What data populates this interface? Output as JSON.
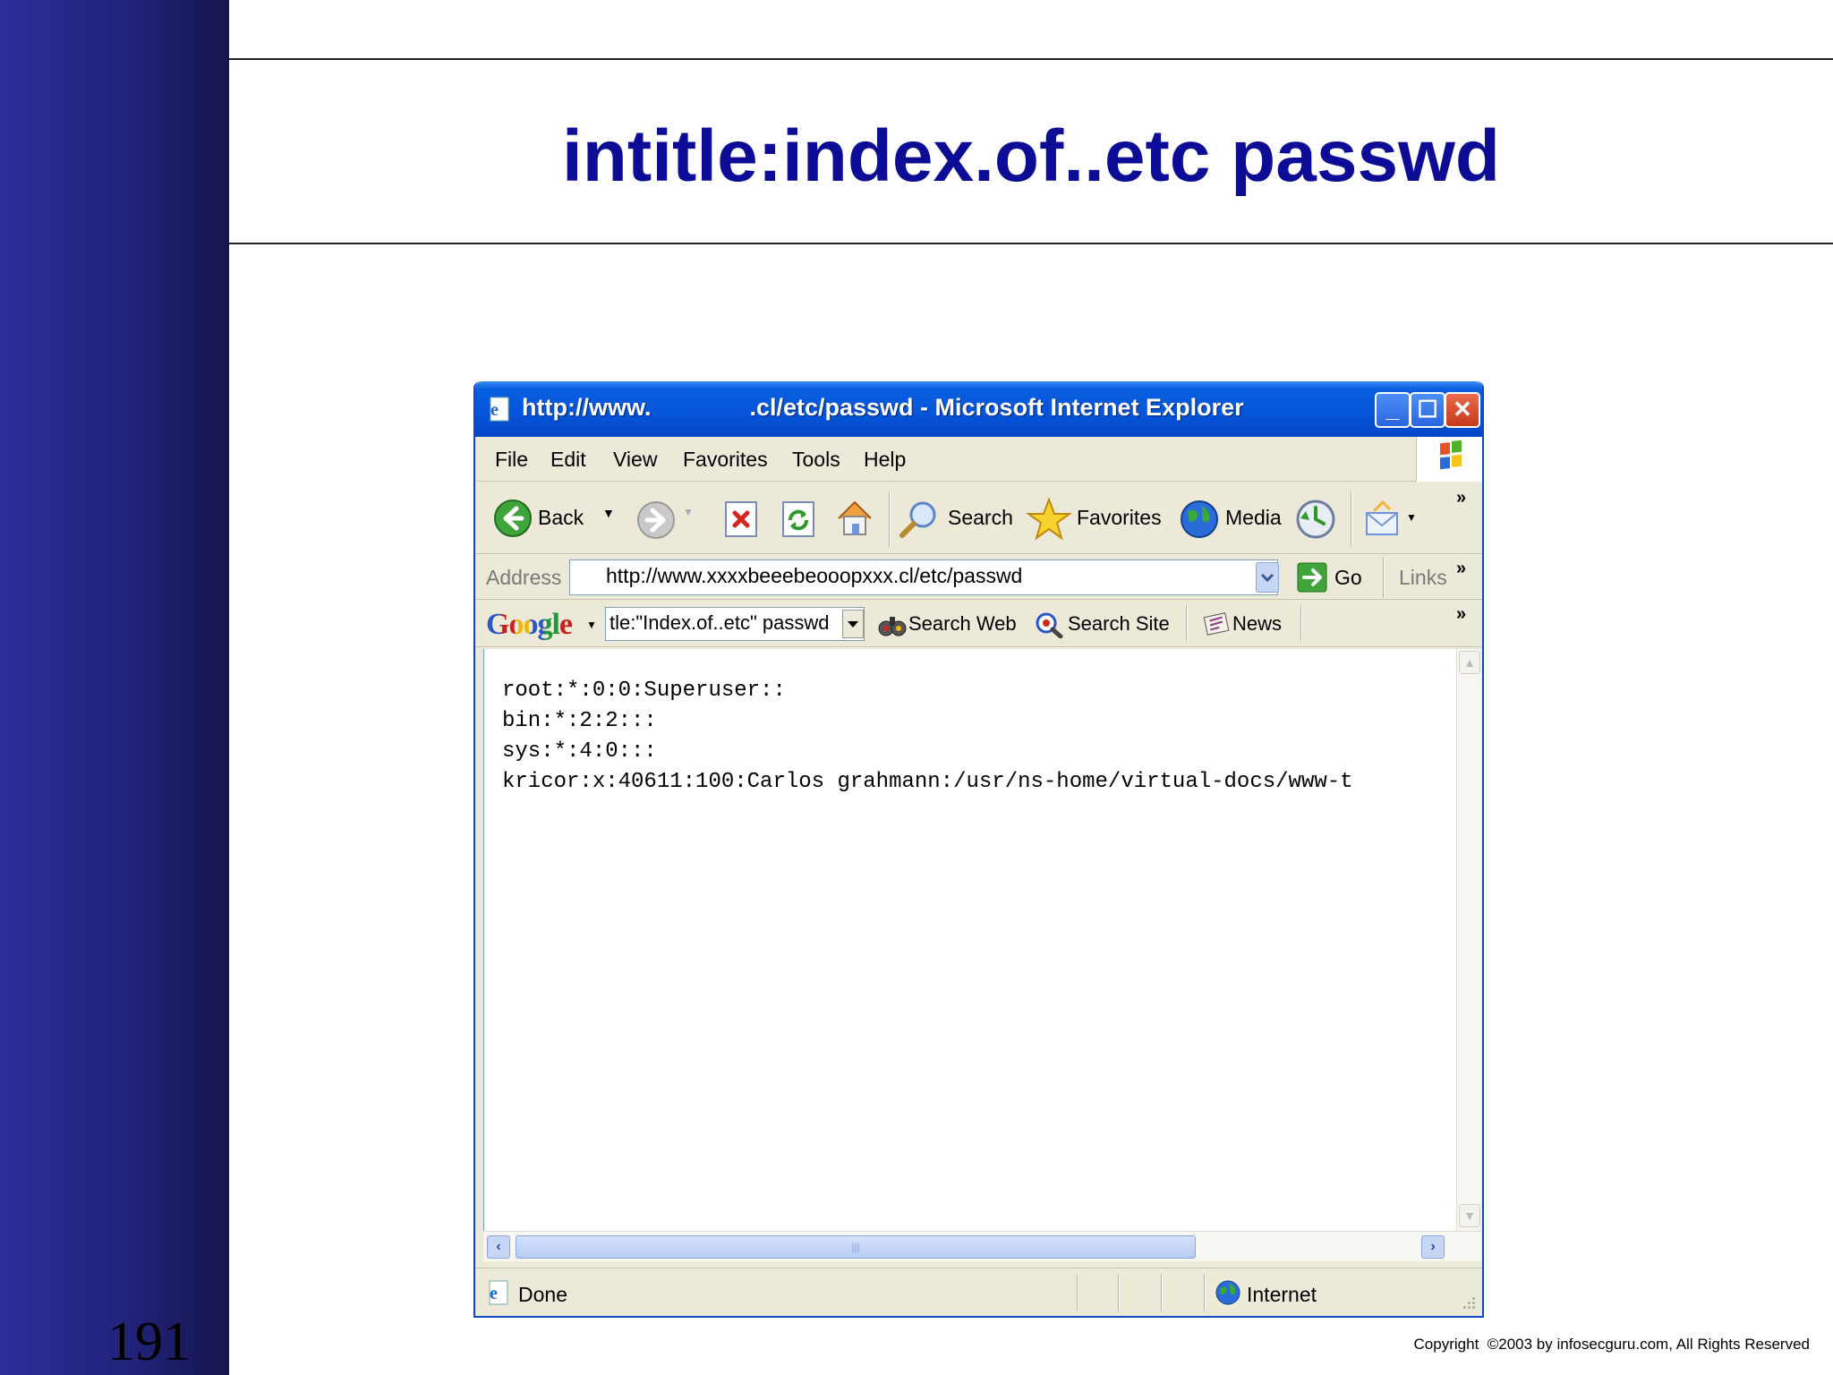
{
  "slide": {
    "title": "intitle:index.of..etc passwd",
    "number": "191",
    "copyright": "Copyright  ©2003 by infosecguru.com, All Rights Reserved"
  },
  "window": {
    "title_prefix": "http://www.",
    "title_suffix": ".cl/etc/passwd - Microsoft Internet Explorer"
  },
  "menu": [
    "File",
    "Edit",
    "View",
    "Favorites",
    "Tools",
    "Help"
  ],
  "toolbar": {
    "back_label": "Back",
    "search_label": "Search",
    "favorites_label": "Favorites",
    "media_label": "Media"
  },
  "address": {
    "label": "Address",
    "value": "http://www.xxxxbeeebeooopxxx.cl/etc/passwd",
    "go_label": "Go",
    "links_label": "Links"
  },
  "google_bar": {
    "logo": "Google",
    "query": "tle:\"Index.of..etc\" passwd",
    "search_web": "Search Web",
    "search_site": "Search Site",
    "news": "News"
  },
  "content": {
    "lines": [
      "root:*:0:0:Superuser::",
      "bin:*:2:2:::",
      "sys:*:4:0:::",
      "kricor:x:40611:100:Carlos grahmann:/usr/ns-home/virtual-docs/www-t"
    ]
  },
  "status": {
    "text": "Done",
    "zone": "Internet"
  },
  "colors": {
    "title_blue": "#0c0c96",
    "xp_titlebar": "#0554d9",
    "sidebar": "#22237a"
  }
}
